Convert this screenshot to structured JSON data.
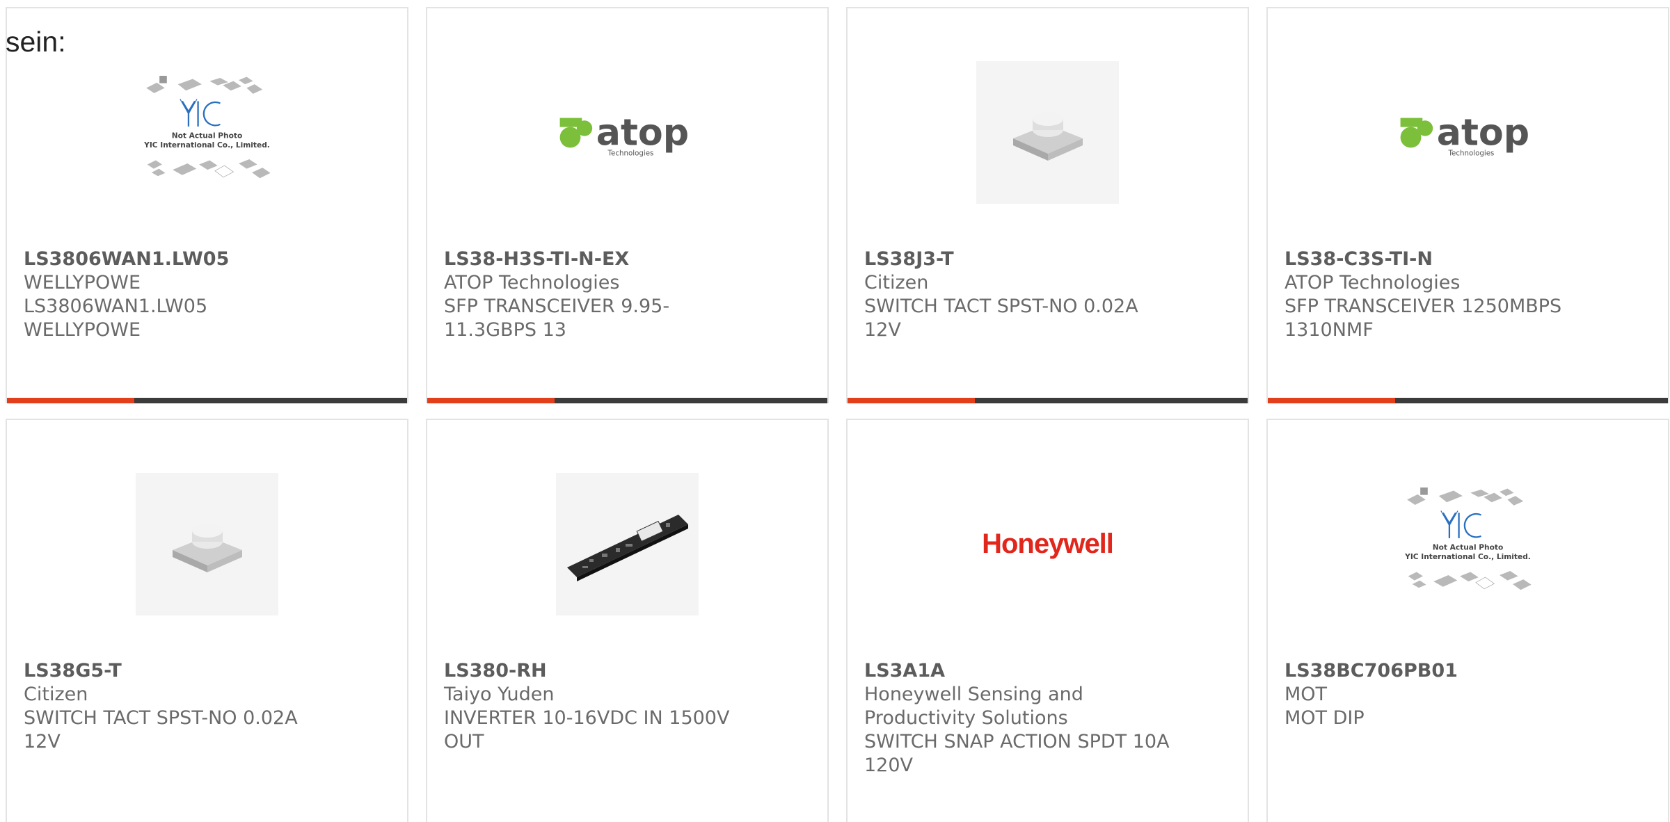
{
  "lead_text": "sein:",
  "colors": {
    "accent": "#e2401c",
    "bar": "#3b3b3b",
    "atop_green": "#7bbf3a",
    "atop_gray": "#555555",
    "honeywell_red": "#e1261c",
    "yic_blue": "#2a6fc0"
  },
  "yic_caption": {
    "line1": "Not Actual Photo",
    "line2": "YIC International Co., Limited."
  },
  "atop": {
    "word": "atop",
    "tagline": "Technologies"
  },
  "honeywell": "Honeywell",
  "products": [
    {
      "image": "yic-placeholder",
      "part": "LS3806WAN1.LW05",
      "manufacturer": "WELLYPOWE",
      "description": "LS3806WAN1.LW05 WELLYPOWE"
    },
    {
      "image": "atop-logo",
      "part": "LS38-H3S-TI-N-EX",
      "manufacturer": "ATOP Technologies",
      "description": "SFP TRANSCEIVER 9.95-11.3GBPS 13"
    },
    {
      "image": "tact-switch-photo",
      "part": "LS38J3-T",
      "manufacturer": "Citizen",
      "description": "SWITCH TACT SPST-NO 0.02A 12V"
    },
    {
      "image": "atop-logo",
      "part": "LS38-C3S-TI-N",
      "manufacturer": "ATOP Technologies",
      "description": "SFP TRANSCEIVER 1250MBPS 1310NMF"
    },
    {
      "image": "tact-switch-photo",
      "part": "LS38G5-T",
      "manufacturer": "Citizen",
      "description": "SWITCH TACT SPST-NO 0.02A 12V"
    },
    {
      "image": "inverter-board-photo",
      "part": "LS380-RH",
      "manufacturer": "Taiyo Yuden",
      "description": "INVERTER 10-16VDC IN 1500V OUT"
    },
    {
      "image": "honeywell-logo",
      "part": "LS3A1A",
      "manufacturer": "Honeywell Sensing and Productivity Solutions",
      "description": "SWITCH SNAP ACTION SPDT 10A 120V"
    },
    {
      "image": "yic-placeholder",
      "part": "LS38BC706PB01",
      "manufacturer": "MOT",
      "description": "MOT DIP"
    }
  ]
}
